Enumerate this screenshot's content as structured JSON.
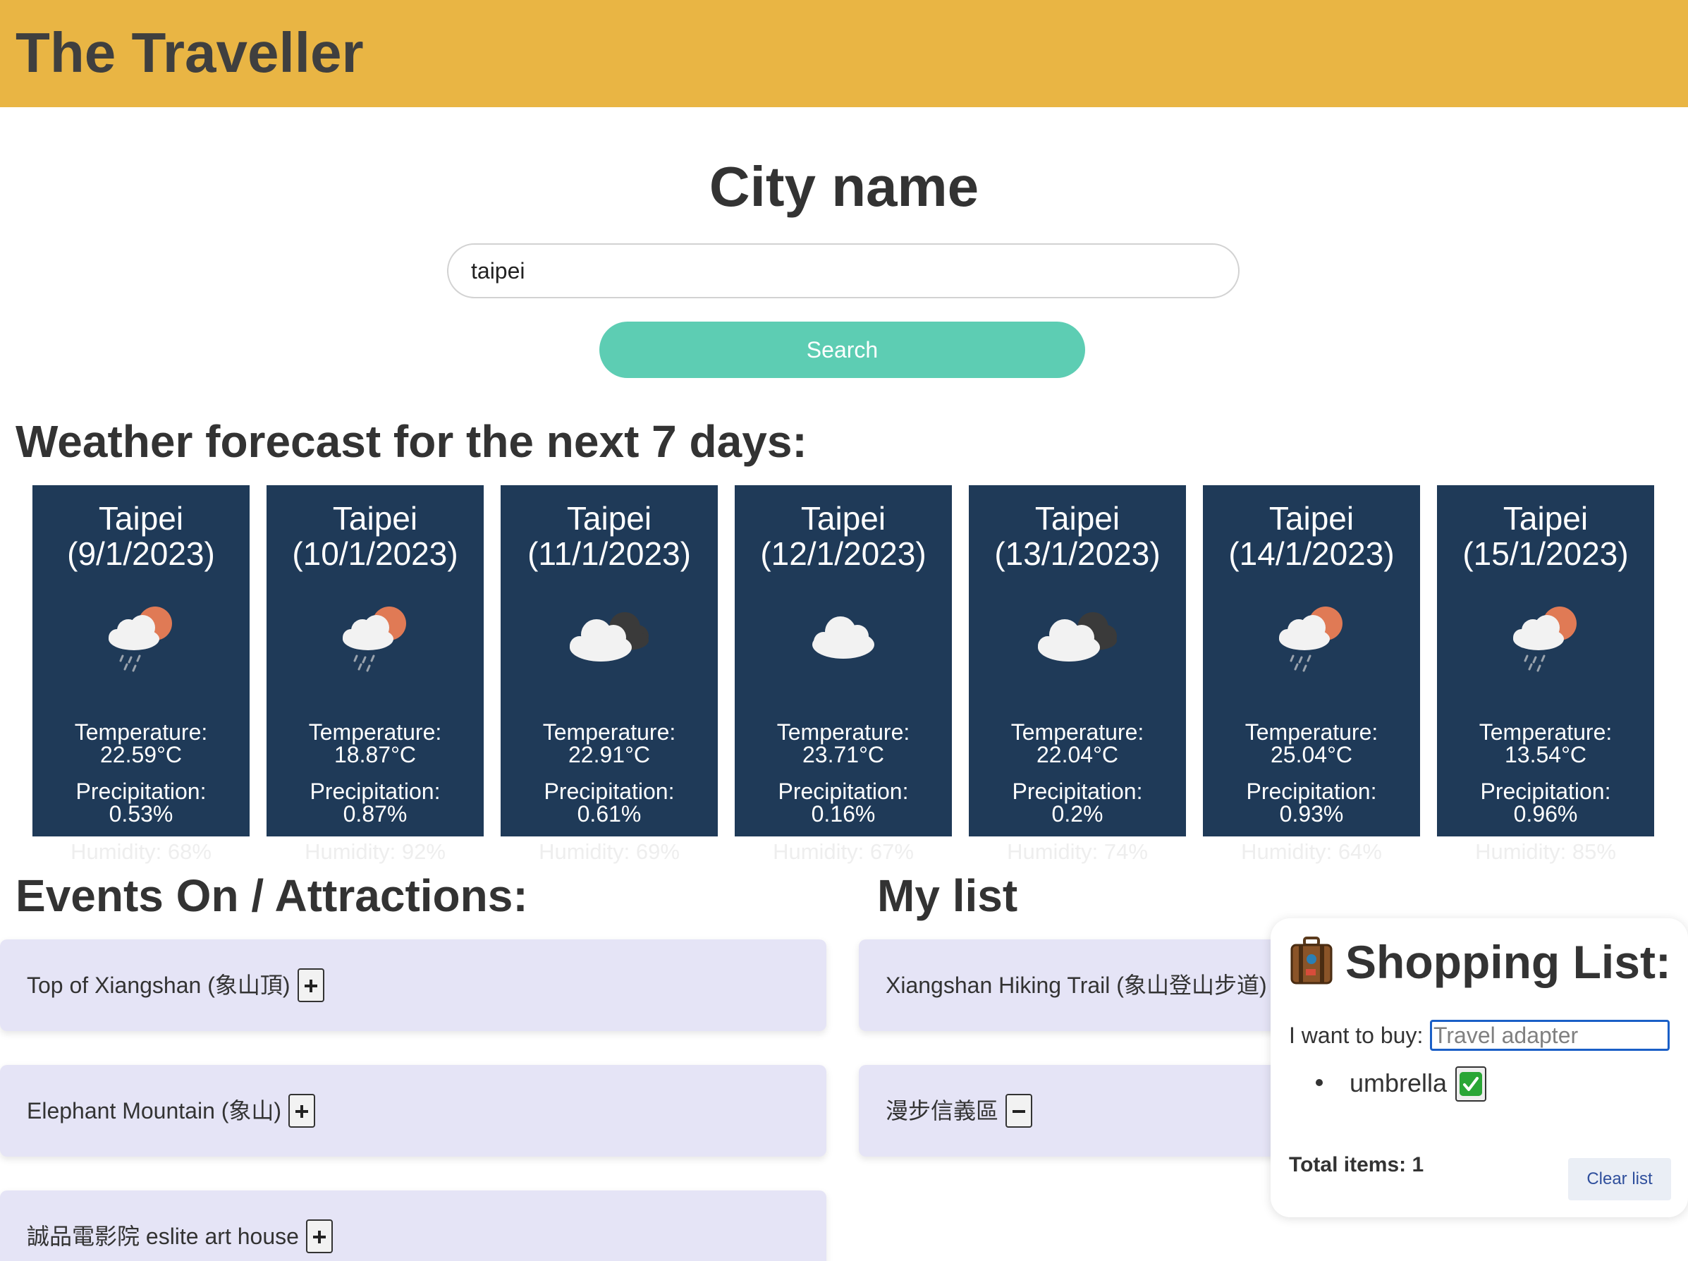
{
  "header": {
    "title": "The Traveller"
  },
  "search": {
    "heading": "City name",
    "value": "taipei",
    "button_label": "Search"
  },
  "forecast": {
    "heading": "Weather forecast for the next 7 days:",
    "days": [
      {
        "title": "Taipei (9/1/2023)",
        "icon": "sun-cloud-rain-icon",
        "temp_label": "Temperature:",
        "temp": "22.59°C",
        "precip_label": "Precipitation:",
        "precip": "0.53%",
        "humidity": "Humidity: 68%"
      },
      {
        "title": "Taipei (10/1/2023)",
        "icon": "sun-cloud-rain-icon",
        "temp_label": "Temperature:",
        "temp": "18.87°C",
        "precip_label": "Precipitation:",
        "precip": "0.87%",
        "humidity": "Humidity: 92%"
      },
      {
        "title": "Taipei (11/1/2023)",
        "icon": "overcast-clouds-icon",
        "temp_label": "Temperature:",
        "temp": "22.91°C",
        "precip_label": "Precipitation:",
        "precip": "0.61%",
        "humidity": "Humidity: 69%"
      },
      {
        "title": "Taipei (12/1/2023)",
        "icon": "cloud-icon",
        "temp_label": "Temperature:",
        "temp": "23.71°C",
        "precip_label": "Precipitation:",
        "precip": "0.16%",
        "humidity": "Humidity: 67%"
      },
      {
        "title": "Taipei (13/1/2023)",
        "icon": "overcast-clouds-icon",
        "temp_label": "Temperature:",
        "temp": "22.04°C",
        "precip_label": "Precipitation:",
        "precip": "0.2%",
        "humidity": "Humidity: 74%"
      },
      {
        "title": "Taipei (14/1/2023)",
        "icon": "sun-cloud-rain-icon",
        "temp_label": "Temperature:",
        "temp": "25.04°C",
        "precip_label": "Precipitation:",
        "precip": "0.93%",
        "humidity": "Humidity: 64%"
      },
      {
        "title": "Taipei (15/1/2023)",
        "icon": "sun-cloud-rain-icon",
        "temp_label": "Temperature:",
        "temp": "13.54°C",
        "precip_label": "Precipitation:",
        "precip": "0.96%",
        "humidity": "Humidity: 85%"
      }
    ]
  },
  "events": {
    "heading": "Events On / Attractions:",
    "items": [
      {
        "label": "Top of Xiangshan (象山頂)",
        "action": "add"
      },
      {
        "label": "Elephant Mountain (象山)",
        "action": "add"
      },
      {
        "label": "誠品電影院 eslite art house",
        "action": "add"
      }
    ]
  },
  "mylist": {
    "heading": "My list",
    "items": [
      {
        "label": "Xiangshan Hiking Trail (象山登山步道)",
        "action": "remove"
      },
      {
        "label": "漫步信義區",
        "action": "remove"
      }
    ]
  },
  "shopping": {
    "icon": "suitcase-icon",
    "title": "Shopping List:",
    "want_label": "I want to buy:",
    "input_placeholder": "Travel adapter",
    "items": [
      {
        "label": "umbrella",
        "done": true
      }
    ],
    "total": "Total items: 1",
    "clear_label": "Clear list"
  },
  "colors": {
    "header": "#e9b544",
    "card": "#1f3a58",
    "accent": "#5dcdb3",
    "item_bg": "#e5e4f6"
  }
}
